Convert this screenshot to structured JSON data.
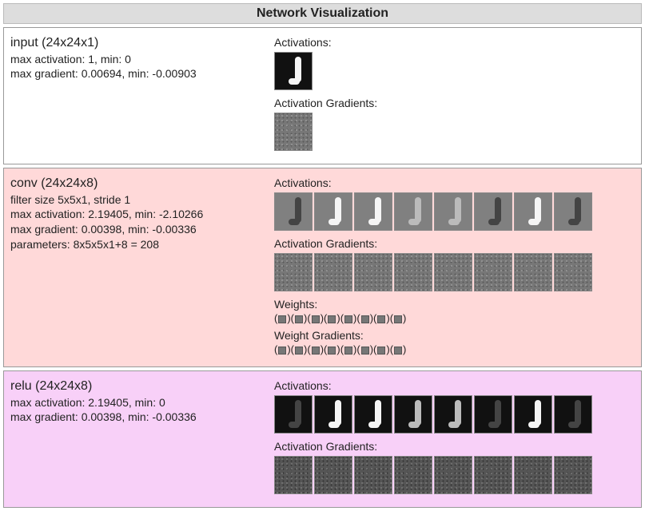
{
  "header": {
    "title": "Network Visualization"
  },
  "layers": {
    "input": {
      "title": "input (24x24x1)",
      "line_act": "max activation: 1, min: 0",
      "line_grad": "max gradient: 0.00694, min: -0.00903",
      "label_activations": "Activations:",
      "label_act_grads": "Activation Gradients:"
    },
    "conv": {
      "title": "conv (24x24x8)",
      "line_filter": "filter size 5x5x1, stride 1",
      "line_act": "max activation: 2.19405, min: -2.10266",
      "line_grad": "max gradient: 0.00398, min: -0.00336",
      "line_params": "parameters: 8x5x5x1+8 = 208",
      "label_activations": "Activations:",
      "label_act_grads": "Activation Gradients:",
      "label_weights": "Weights:",
      "label_weight_grads": "Weight Gradients:"
    },
    "relu": {
      "title": "relu (24x24x8)",
      "line_act": "max activation: 2.19405, min: 0",
      "line_grad": "max gradient: 0.00398, min: -0.00336",
      "label_activations": "Activations:",
      "label_act_grads": "Activation Gradients:"
    }
  }
}
